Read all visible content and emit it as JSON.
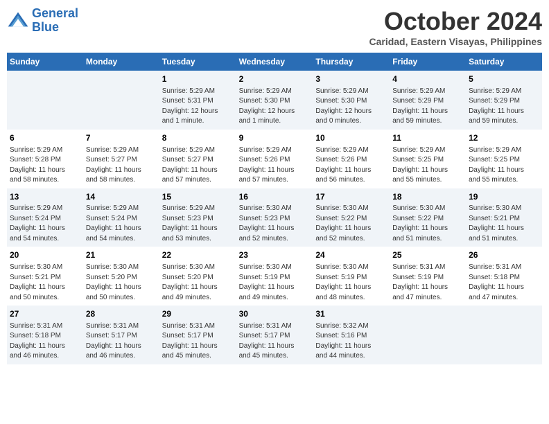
{
  "logo": {
    "line1": "General",
    "line2": "Blue"
  },
  "title": "October 2024",
  "subtitle": "Caridad, Eastern Visayas, Philippines",
  "weekdays": [
    "Sunday",
    "Monday",
    "Tuesday",
    "Wednesday",
    "Thursday",
    "Friday",
    "Saturday"
  ],
  "weeks": [
    [
      {
        "day": "",
        "info": ""
      },
      {
        "day": "",
        "info": ""
      },
      {
        "day": "1",
        "info": "Sunrise: 5:29 AM\nSunset: 5:31 PM\nDaylight: 12 hours\nand 1 minute."
      },
      {
        "day": "2",
        "info": "Sunrise: 5:29 AM\nSunset: 5:30 PM\nDaylight: 12 hours\nand 1 minute."
      },
      {
        "day": "3",
        "info": "Sunrise: 5:29 AM\nSunset: 5:30 PM\nDaylight: 12 hours\nand 0 minutes."
      },
      {
        "day": "4",
        "info": "Sunrise: 5:29 AM\nSunset: 5:29 PM\nDaylight: 11 hours\nand 59 minutes."
      },
      {
        "day": "5",
        "info": "Sunrise: 5:29 AM\nSunset: 5:29 PM\nDaylight: 11 hours\nand 59 minutes."
      }
    ],
    [
      {
        "day": "6",
        "info": "Sunrise: 5:29 AM\nSunset: 5:28 PM\nDaylight: 11 hours\nand 58 minutes."
      },
      {
        "day": "7",
        "info": "Sunrise: 5:29 AM\nSunset: 5:27 PM\nDaylight: 11 hours\nand 58 minutes."
      },
      {
        "day": "8",
        "info": "Sunrise: 5:29 AM\nSunset: 5:27 PM\nDaylight: 11 hours\nand 57 minutes."
      },
      {
        "day": "9",
        "info": "Sunrise: 5:29 AM\nSunset: 5:26 PM\nDaylight: 11 hours\nand 57 minutes."
      },
      {
        "day": "10",
        "info": "Sunrise: 5:29 AM\nSunset: 5:26 PM\nDaylight: 11 hours\nand 56 minutes."
      },
      {
        "day": "11",
        "info": "Sunrise: 5:29 AM\nSunset: 5:25 PM\nDaylight: 11 hours\nand 55 minutes."
      },
      {
        "day": "12",
        "info": "Sunrise: 5:29 AM\nSunset: 5:25 PM\nDaylight: 11 hours\nand 55 minutes."
      }
    ],
    [
      {
        "day": "13",
        "info": "Sunrise: 5:29 AM\nSunset: 5:24 PM\nDaylight: 11 hours\nand 54 minutes."
      },
      {
        "day": "14",
        "info": "Sunrise: 5:29 AM\nSunset: 5:24 PM\nDaylight: 11 hours\nand 54 minutes."
      },
      {
        "day": "15",
        "info": "Sunrise: 5:29 AM\nSunset: 5:23 PM\nDaylight: 11 hours\nand 53 minutes."
      },
      {
        "day": "16",
        "info": "Sunrise: 5:30 AM\nSunset: 5:23 PM\nDaylight: 11 hours\nand 52 minutes."
      },
      {
        "day": "17",
        "info": "Sunrise: 5:30 AM\nSunset: 5:22 PM\nDaylight: 11 hours\nand 52 minutes."
      },
      {
        "day": "18",
        "info": "Sunrise: 5:30 AM\nSunset: 5:22 PM\nDaylight: 11 hours\nand 51 minutes."
      },
      {
        "day": "19",
        "info": "Sunrise: 5:30 AM\nSunset: 5:21 PM\nDaylight: 11 hours\nand 51 minutes."
      }
    ],
    [
      {
        "day": "20",
        "info": "Sunrise: 5:30 AM\nSunset: 5:21 PM\nDaylight: 11 hours\nand 50 minutes."
      },
      {
        "day": "21",
        "info": "Sunrise: 5:30 AM\nSunset: 5:20 PM\nDaylight: 11 hours\nand 50 minutes."
      },
      {
        "day": "22",
        "info": "Sunrise: 5:30 AM\nSunset: 5:20 PM\nDaylight: 11 hours\nand 49 minutes."
      },
      {
        "day": "23",
        "info": "Sunrise: 5:30 AM\nSunset: 5:19 PM\nDaylight: 11 hours\nand 49 minutes."
      },
      {
        "day": "24",
        "info": "Sunrise: 5:30 AM\nSunset: 5:19 PM\nDaylight: 11 hours\nand 48 minutes."
      },
      {
        "day": "25",
        "info": "Sunrise: 5:31 AM\nSunset: 5:19 PM\nDaylight: 11 hours\nand 47 minutes."
      },
      {
        "day": "26",
        "info": "Sunrise: 5:31 AM\nSunset: 5:18 PM\nDaylight: 11 hours\nand 47 minutes."
      }
    ],
    [
      {
        "day": "27",
        "info": "Sunrise: 5:31 AM\nSunset: 5:18 PM\nDaylight: 11 hours\nand 46 minutes."
      },
      {
        "day": "28",
        "info": "Sunrise: 5:31 AM\nSunset: 5:17 PM\nDaylight: 11 hours\nand 46 minutes."
      },
      {
        "day": "29",
        "info": "Sunrise: 5:31 AM\nSunset: 5:17 PM\nDaylight: 11 hours\nand 45 minutes."
      },
      {
        "day": "30",
        "info": "Sunrise: 5:31 AM\nSunset: 5:17 PM\nDaylight: 11 hours\nand 45 minutes."
      },
      {
        "day": "31",
        "info": "Sunrise: 5:32 AM\nSunset: 5:16 PM\nDaylight: 11 hours\nand 44 minutes."
      },
      {
        "day": "",
        "info": ""
      },
      {
        "day": "",
        "info": ""
      }
    ]
  ]
}
